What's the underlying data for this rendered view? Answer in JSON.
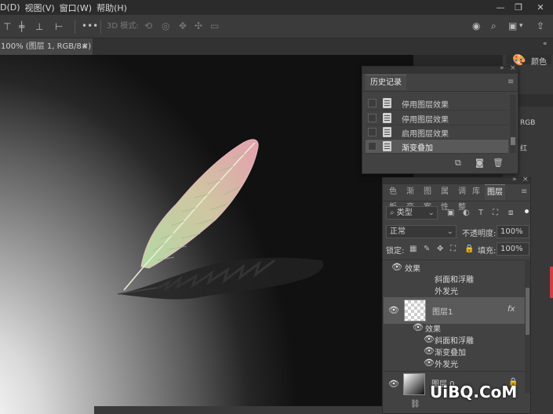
{
  "menubar": {
    "items": [
      "D(D)",
      "视图(V)",
      "窗口(W)",
      "帮助(H)"
    ]
  },
  "optionsbar": {
    "mode_3d": "3D 模式:",
    "more": "•••"
  },
  "document": {
    "tab_title": "100% (图层 1, RGB/8#) *",
    "tab_close": "×"
  },
  "history_panel": {
    "title": "历史记录",
    "items": [
      {
        "label": "停用图层效果"
      },
      {
        "label": "停用图层效果"
      },
      {
        "label": "启用图层效果"
      },
      {
        "label": "渐变叠加"
      }
    ]
  },
  "right_dock": {
    "color_label": "颜色",
    "rgb_label": "RGB",
    "red_label": "红"
  },
  "layers_panel": {
    "tabs": [
      "色板",
      "渐变",
      "图案",
      "属性",
      "调整",
      "库",
      "图层"
    ],
    "active_tab": "图层",
    "filter_kind": "类型",
    "blend_mode": "正常",
    "opacity_label": "不透明度:",
    "opacity_value": "100%",
    "lock_label": "锁定:",
    "fill_label": "填充:",
    "fill_value": "100%",
    "layers": [
      {
        "name": "效果",
        "effects": [
          "斜面和浮雕",
          "外发光"
        ]
      },
      {
        "name": "图层1",
        "fx": "fx",
        "effects_title": "效果",
        "effects": [
          "斜面和浮雕",
          "渐变叠加",
          "外发光"
        ]
      },
      {
        "name": "图层 0"
      }
    ]
  },
  "watermark": {
    "text": "UiBQ.CoM"
  },
  "colors": {
    "menubar_bg": "#2b2b2b",
    "panel_bg": "#424242",
    "selected_row": "#5a5a5a",
    "accent_red": "#d93b3b"
  }
}
